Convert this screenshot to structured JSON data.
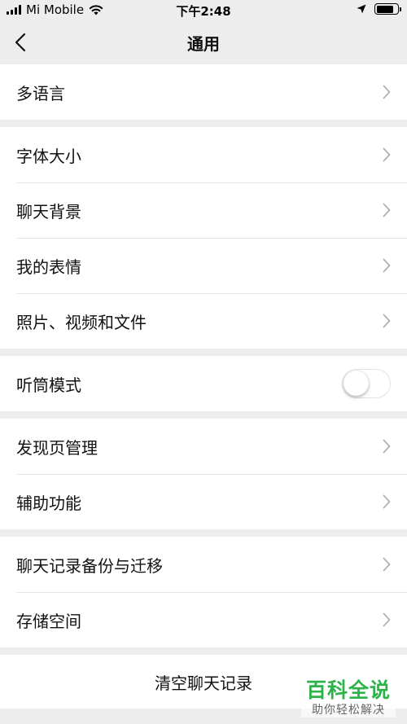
{
  "status_bar": {
    "carrier": "Mi Mobile",
    "time": "下午2:48",
    "icons": [
      "signal-icon",
      "wifi-icon",
      "location-arrow-icon",
      "battery-icon"
    ]
  },
  "nav": {
    "title": "通用",
    "back_icon": "chevron-left-icon"
  },
  "groups": [
    {
      "items": [
        {
          "label": "多语言"
        }
      ]
    },
    {
      "items": [
        {
          "label": "字体大小"
        },
        {
          "label": "聊天背景"
        },
        {
          "label": "我的表情"
        },
        {
          "label": "照片、视频和文件"
        }
      ]
    },
    {
      "items": [
        {
          "label": "听筒模式",
          "toggle": false
        }
      ]
    },
    {
      "items": [
        {
          "label": "发现页管理"
        },
        {
          "label": "辅助功能"
        }
      ]
    },
    {
      "items": [
        {
          "label": "聊天记录备份与迁移"
        },
        {
          "label": "存储空间"
        }
      ]
    }
  ],
  "clear_button": {
    "label": "清空聊天记录"
  },
  "watermark": {
    "title": "百科全说",
    "subtitle": "助你轻松解决"
  },
  "colors": {
    "background": "#ededed",
    "card": "#ffffff",
    "chevron": "#b2b2b2",
    "watermark_green": "#2cb34a"
  }
}
